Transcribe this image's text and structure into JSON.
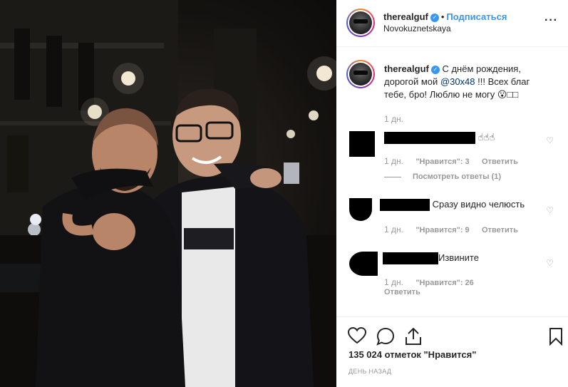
{
  "post": {
    "username": "therealguf",
    "follow_label": "Подписаться",
    "separator": "•",
    "location": "Novokuznetskaya",
    "more_icon": "more-dots-icon"
  },
  "caption": {
    "username": "therealguf",
    "text_before": "С днём рождения, дорогой мой ",
    "mention": "@30x48",
    "text_after": " !!! Всех благ тебе, бро! Люблю не могу 😮□□",
    "time": "1 дн."
  },
  "comments": [
    {
      "text": "☝☝☝",
      "time": "1 дн.",
      "likes": "\"Нравится\": 3",
      "reply_label": "Ответить",
      "view_replies": "Посмотреть ответы (1)"
    },
    {
      "text": "Сразу видно челюсть",
      "time": "1 дн.",
      "likes": "\"Нравится\": 9",
      "reply_label": "Ответить"
    },
    {
      "text": "Извините",
      "time": "1 дн.",
      "likes": "\"Нравится\": 26",
      "reply_label": "Ответить"
    }
  ],
  "actions": {
    "like_icon": "heart-icon",
    "comment_icon": "comment-icon",
    "share_icon": "share-icon",
    "save_icon": "bookmark-icon"
  },
  "likes_text": "135 024 отметок \"Нравится\"",
  "time_ago": "ДЕНЬ НАЗАД",
  "colors": {
    "link_blue": "#3897f0",
    "mention_blue": "#003569",
    "muted": "#999999",
    "border": "#efefef"
  }
}
